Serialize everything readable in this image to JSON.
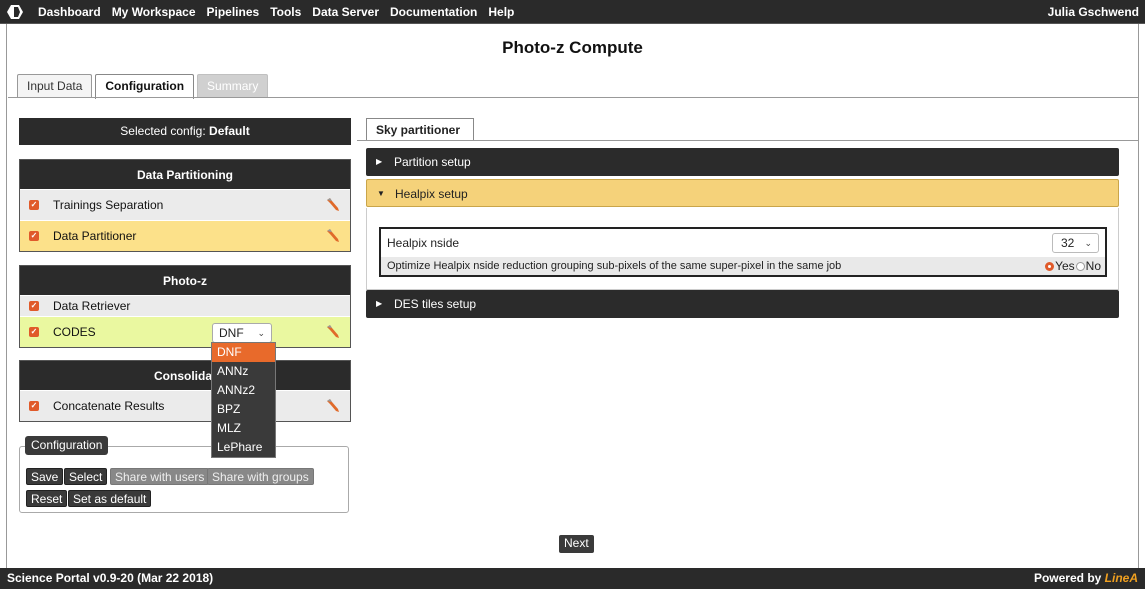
{
  "nav": {
    "items": [
      "Dashboard",
      "My Workspace",
      "Pipelines",
      "Tools",
      "Data Server",
      "Documentation",
      "Help"
    ],
    "user": "Julia Gschwend"
  },
  "page_title": "Photo-z Compute",
  "main_tabs": [
    "Input Data",
    "Configuration",
    "Summary"
  ],
  "selected_config": {
    "prefix": "Selected config: ",
    "name": "Default"
  },
  "partitioning": {
    "title": "Data Partitioning",
    "rows": [
      "Trainings Separation",
      "Data Partitioner"
    ]
  },
  "photoz": {
    "title": "Photo-z",
    "rows": [
      "Data Retriever",
      "CODES"
    ],
    "codes_selected": "DNF"
  },
  "consolidation": {
    "title": "Consolidat",
    "rows": [
      "Concatenate Results"
    ]
  },
  "dropdown_options": [
    "DNF",
    "ANNz",
    "ANNz2",
    "BPZ",
    "MLZ",
    "LePhare"
  ],
  "config_box": {
    "legend": "Configuration",
    "buttons": [
      "Save",
      "Select",
      "Share with users",
      "Share with groups",
      "Reset",
      "Set as default"
    ]
  },
  "sky_tab": "Sky partitioner",
  "accordion": {
    "partition": "Partition setup",
    "healpix": "Healpix setup",
    "des": "DES tiles setup"
  },
  "healpix": {
    "nside_label": "Healpix nside",
    "nside_value": "32",
    "optimize_label": "Optimize Healpix nside reduction grouping sub-pixels of the same super-pixel in the same job",
    "yes": "Yes",
    "no": "No"
  },
  "next": "Next",
  "footer": {
    "left": "Science Portal v0.9-20 (Mar 22 2018)",
    "powered": "Powered by ",
    "brand": "LineA"
  },
  "colors": {
    "accent": "#e05a2a",
    "highlight_orange": "#fce18a",
    "highlight_green": "#eaf8a0",
    "header_dark": "#2b2b2b"
  }
}
